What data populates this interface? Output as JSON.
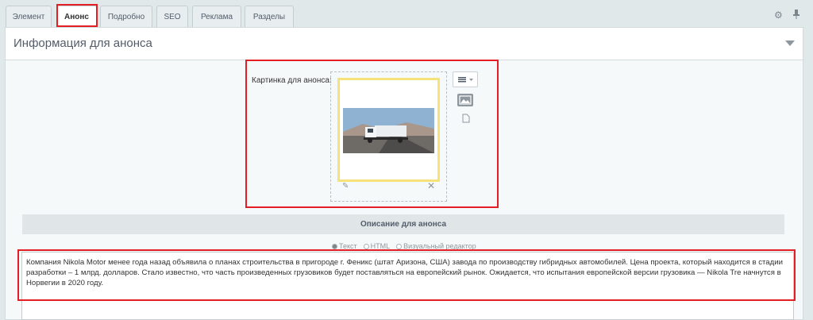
{
  "tabs": [
    {
      "label": "Элемент",
      "active": false
    },
    {
      "label": "Анонс",
      "active": true
    },
    {
      "label": "Подробно",
      "active": false
    },
    {
      "label": "SEO",
      "active": false
    },
    {
      "label": "Реклама",
      "active": false
    },
    {
      "label": "Разделы",
      "active": false
    }
  ],
  "toolbar": {
    "settings_icon": "gear-icon",
    "pin_icon": "pin-icon"
  },
  "section": {
    "title": "Информация для анонса",
    "picture_label": "Картинка для анонса:",
    "description_title": "Описание для анонса"
  },
  "editor_modes": [
    {
      "label": "Текст",
      "selected": true
    },
    {
      "label": "HTML",
      "selected": false
    },
    {
      "label": "Визуальный редактор",
      "selected": false
    }
  ],
  "description_text": "Компания Nikola Motor менее года назад объявила о планах строительства в пригороде г. Феникс (штат Аризона, США) завода по производству гибридных автомобилей. Цена проекта, который находится в стадии разработки – 1 млрд. долларов. Стало известно, что часть произведенных грузовиков будет поставляться на европейский рынок. Ожидается, что испытания европейской версии грузовика — Nikola Tre начнутся в Норвегии в 2020 году.",
  "colors": {
    "highlight": "#e31e24",
    "image_border": "#f6e27b",
    "background": "#e0e8ea"
  }
}
